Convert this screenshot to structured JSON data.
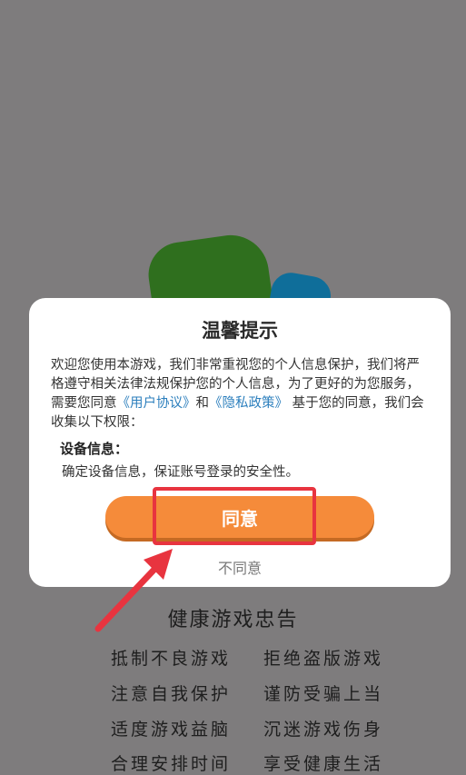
{
  "dialog": {
    "title": "温馨提示",
    "intro_before": "欢迎您使用本游戏，我们非常重视您的个人信息保护，我们将严格遵守相关法律法规保护您的个人信息，为了更好的为您服务，需要您同意",
    "user_agreement_link": "《用户协议》",
    "and_text": "和",
    "privacy_policy_link": "《隐私政策》",
    "intro_after": " 基于您的同意，我们会收集以下权限：",
    "device_info_heading": "设备信息：",
    "device_info_text": "确定设备信息，保证账号登录的安全性。",
    "agree_label": "同意",
    "disagree_label": "不同意"
  },
  "advice": {
    "title": "健康游戏忠告",
    "lines": [
      [
        "抵制不良游戏",
        "拒绝盗版游戏"
      ],
      [
        "注意自我保护",
        "谨防受骗上当"
      ],
      [
        "适度游戏益脑",
        "沉迷游戏伤身"
      ],
      [
        "合理安排时间",
        "享受健康生活"
      ]
    ]
  },
  "colors": {
    "overlay_gray": "#7e7c7d",
    "agree_orange": "#f58b3a",
    "link_blue": "#2c7fbd",
    "highlight_red": "#e8343f"
  }
}
